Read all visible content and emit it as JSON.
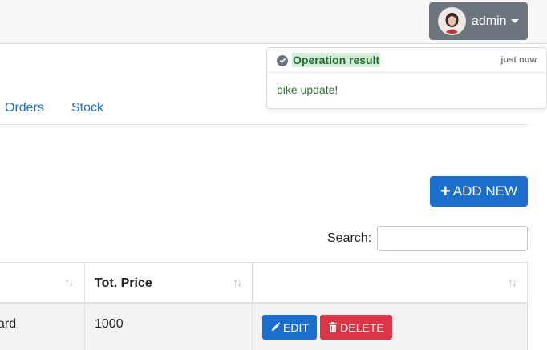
{
  "header": {
    "user_label": "admin"
  },
  "toast": {
    "title": "Operation result",
    "time": "just now",
    "message": "bike update!"
  },
  "nav": {
    "items": [
      {
        "label": "Orders"
      },
      {
        "label": "Stock"
      }
    ]
  },
  "toolbar": {
    "add_label": "ADD NEW",
    "add_icon": "plus-icon"
  },
  "search": {
    "label": "Search:",
    "value": ""
  },
  "table": {
    "columns": [
      {
        "label": ""
      },
      {
        "label": "Tot. Price"
      },
      {
        "label": ""
      }
    ],
    "rows": [
      {
        "cells": [
          "ard",
          "1000"
        ],
        "edit_label": "EDIT",
        "delete_label": "DELETE"
      }
    ]
  },
  "colors": {
    "primary": "#1a6fcd",
    "danger": "#dc3545",
    "secondary": "#6c757d",
    "success_bg": "#d4edda"
  }
}
